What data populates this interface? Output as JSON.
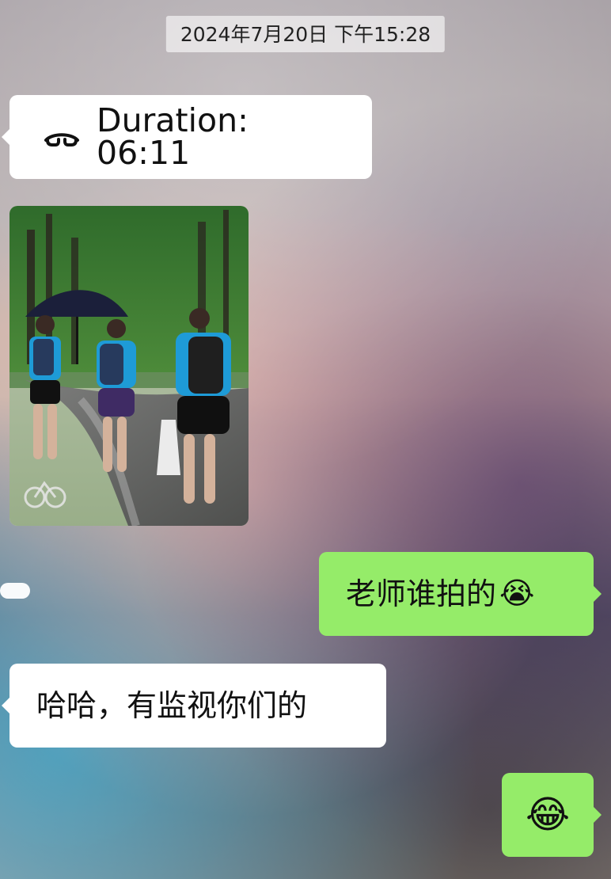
{
  "chat": {
    "timestamp": "2024年7月20日 下午15:28",
    "messages": [
      {
        "id": "call",
        "direction": "received",
        "type": "call",
        "icon": "phone-hangup-icon",
        "text": "Duration: 06:11"
      },
      {
        "id": "photo",
        "direction": "received",
        "type": "image"
      },
      {
        "id": "sent-1",
        "direction": "sent",
        "type": "text",
        "text": "老师谁拍的",
        "emoji": "😭"
      },
      {
        "id": "recv-2",
        "direction": "received",
        "type": "text",
        "text": "哈哈，有监视你们的"
      },
      {
        "id": "sent-3",
        "direction": "sent",
        "type": "text",
        "text": "😂"
      }
    ]
  },
  "colors": {
    "sent_bubble": "#95ec69",
    "received_bubble": "#ffffff",
    "timestamp_bg": "rgba(255,255,255,0.60)"
  }
}
